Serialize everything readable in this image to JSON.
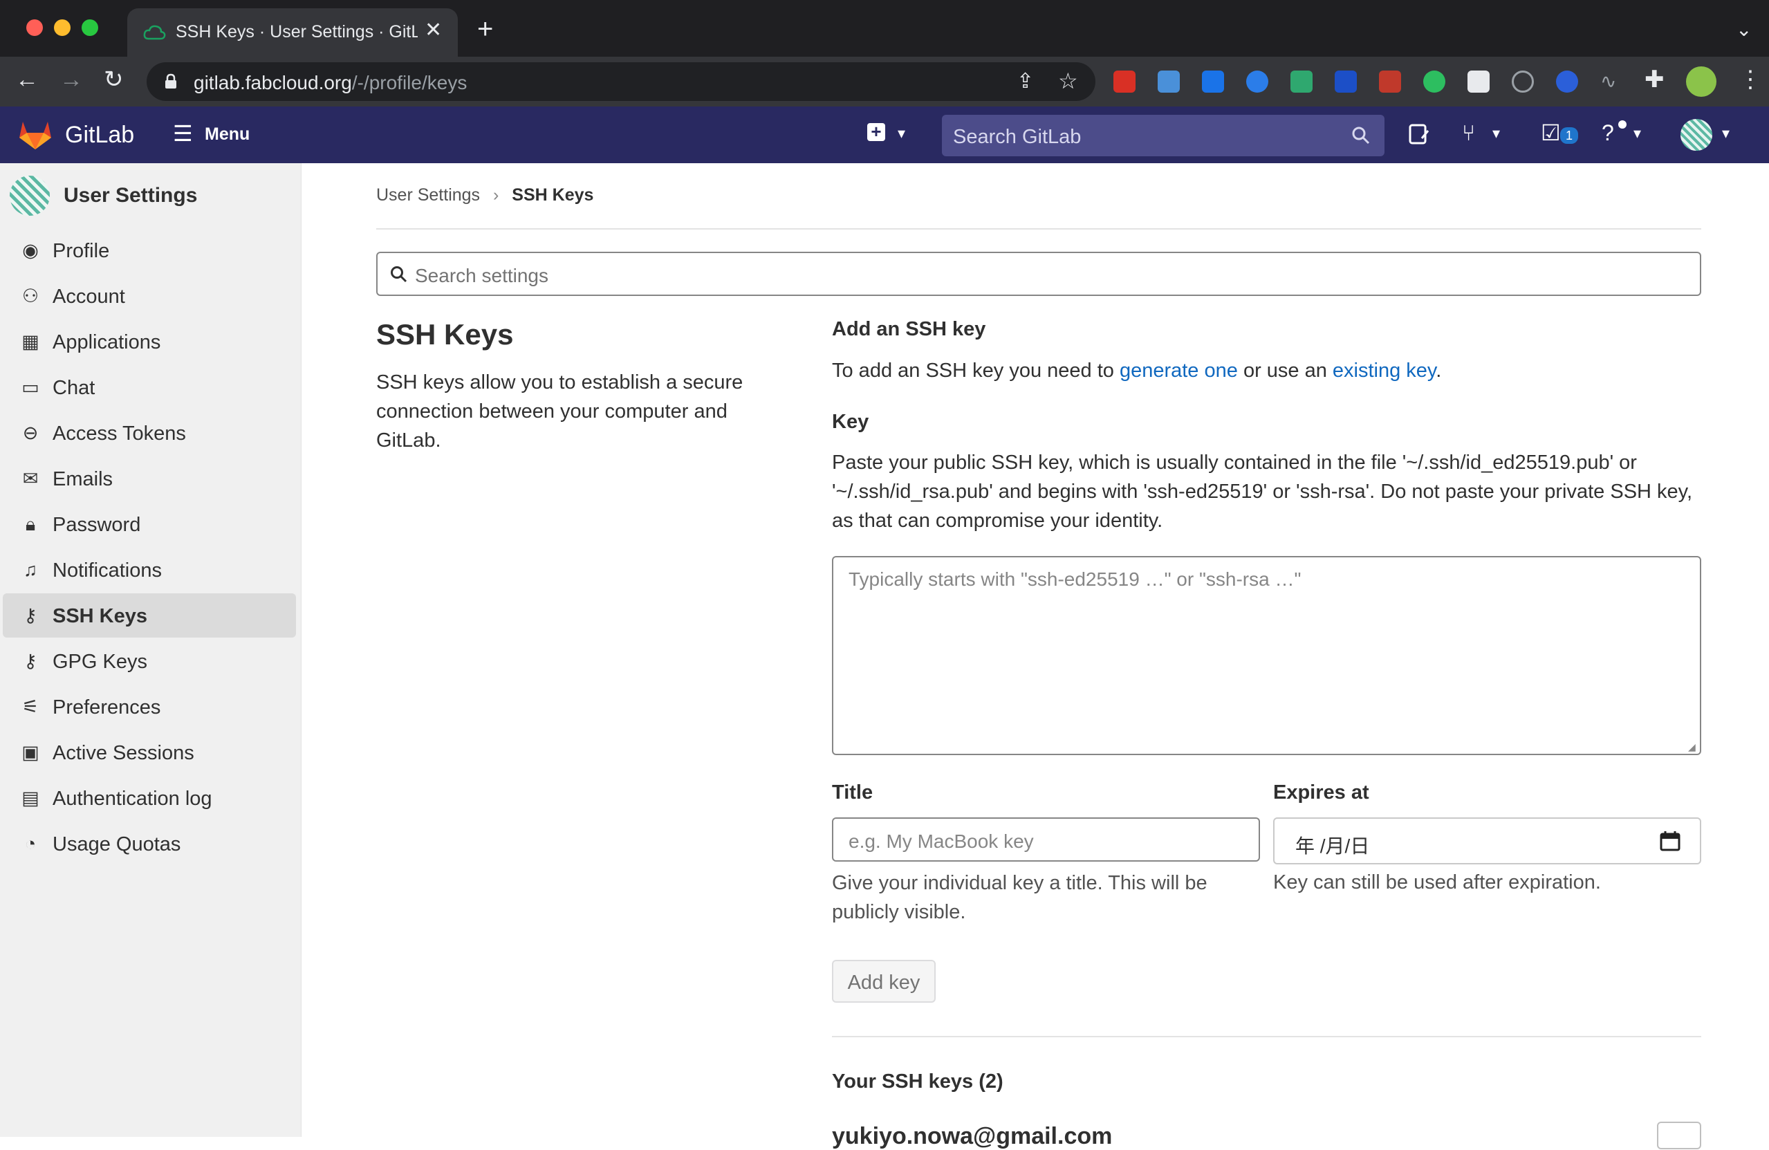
{
  "browser": {
    "tab_title": "SSH Keys · User Settings · GitLab",
    "url_host": "gitlab.fabcloud.org",
    "url_path": "/-/profile/keys"
  },
  "header": {
    "brand": "GitLab",
    "menu_label": "Menu",
    "search_placeholder": "Search GitLab",
    "todos_count": "1"
  },
  "sidebar": {
    "title": "User Settings",
    "items": [
      {
        "label": "Profile",
        "icon": "profile-icon"
      },
      {
        "label": "Account",
        "icon": "account-icon"
      },
      {
        "label": "Applications",
        "icon": "applications-icon"
      },
      {
        "label": "Chat",
        "icon": "chat-icon"
      },
      {
        "label": "Access Tokens",
        "icon": "token-icon"
      },
      {
        "label": "Emails",
        "icon": "mail-icon"
      },
      {
        "label": "Password",
        "icon": "lock-icon"
      },
      {
        "label": "Notifications",
        "icon": "bell-icon"
      },
      {
        "label": "SSH Keys",
        "icon": "key-icon",
        "active": true
      },
      {
        "label": "GPG Keys",
        "icon": "key-icon"
      },
      {
        "label": "Preferences",
        "icon": "preferences-icon"
      },
      {
        "label": "Active Sessions",
        "icon": "monitor-icon"
      },
      {
        "label": "Authentication log",
        "icon": "log-icon"
      },
      {
        "label": "Usage Quotas",
        "icon": "quota-icon"
      }
    ]
  },
  "breadcrumb": {
    "parent": "User Settings",
    "current": "SSH Keys"
  },
  "settings_search_placeholder": "Search settings",
  "intro": {
    "title": "SSH Keys",
    "description": "SSH keys allow you to establish a secure connection between your computer and GitLab."
  },
  "form": {
    "heading": "Add an SSH key",
    "help_prefix": "To add an SSH key you need to ",
    "help_link1": "generate one",
    "help_middle": " or use an ",
    "help_link2": "existing key",
    "help_suffix": ".",
    "key_label": "Key",
    "key_help": "Paste your public SSH key, which is usually contained in the file '~/.ssh/id_ed25519.pub' or '~/.ssh/id_rsa.pub' and begins with 'ssh-ed25519' or 'ssh-rsa'. Do not paste your private SSH key, as that can compromise your identity.",
    "key_placeholder": "Typically starts with \"ssh-ed25519 …\" or \"ssh-rsa …\"",
    "title_label": "Title",
    "title_placeholder": "e.g. My MacBook key",
    "title_help": "Give your individual key a title. This will be publicly visible.",
    "expires_label": "Expires at",
    "expires_value": "年 /月/日",
    "expires_help": "Key can still be used after expiration.",
    "submit_label": "Add key"
  },
  "keys_list": {
    "heading": "Your SSH keys (2)",
    "first_key_title": "yukiyo.nowa@gmail.com"
  }
}
